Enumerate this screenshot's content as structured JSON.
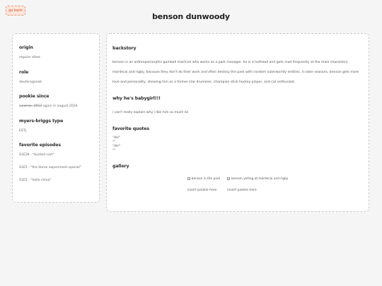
{
  "nav": {
    "go_back": "go back"
  },
  "page": {
    "title": "benson dunwoody"
  },
  "info": [
    {
      "label": "origin",
      "value": "regular show",
      "italic": true
    },
    {
      "label": "role",
      "value": "deuteragonist",
      "italic": false
    },
    {
      "label": "pookie since",
      "value": "a̶w̶w̶r̶o̶x̶.̶ ̶2̶0̶1̶3̶ again in august 2024",
      "italic": false
    },
    {
      "label": "myers-briggs type",
      "value": "ESTJ",
      "italic": false
    }
  ],
  "favorite_episodes": {
    "label": "favorite episodes",
    "items": [
      "S1E26 - \"busted cart\"",
      "S1E5 - \"the dome experiment special\"",
      "S1E5 - \"hello china\""
    ]
  },
  "backstory": {
    "title": "backstory",
    "text": "benson is an anthropomorphic gumball machine who works as a park manager. he is a hothead and gets mad frequently at the main characters, mordecai and rigby, because they don't do their work and often destroy the park with random outerworldy entities. in later seasons, benson gets more love and personality, showing him as a former star drummer, champion stick hockey player, and cat enthusiast."
  },
  "why_babygirl": {
    "title": "why he's babygirl!!!",
    "text": "i can't really explain why i like him so much lol"
  },
  "favorite_quotes": {
    "title": "favorite quotes",
    "items": [
      "\"AH\"",
      "\"\"",
      "\"AH\"",
      "\"\""
    ]
  },
  "gallery": {
    "title": "gallery",
    "items": [
      {
        "alt": "benson in the park",
        "caption": "insert pookie here"
      },
      {
        "alt": "benson yelling at mordecai and rigby",
        "caption": "insert pookie here"
      }
    ]
  }
}
